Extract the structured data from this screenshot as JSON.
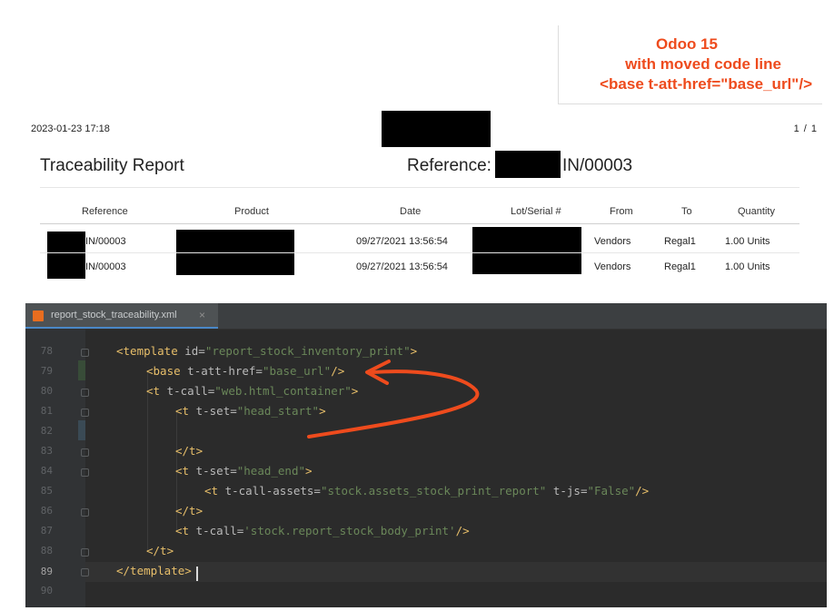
{
  "annotation": {
    "line1": "Odoo 15",
    "line2": "with moved code line",
    "line3": "<base t-att-href=\"base_url\"/>",
    "color": "#ee4b1d"
  },
  "report": {
    "print_date": "2023-01-23 17:18",
    "page": "1 / 1",
    "title": "Traceability Report",
    "reference_label": "Reference:",
    "reference_value": "IN/00003",
    "columns": [
      "Reference",
      "Product",
      "Date",
      "Lot/Serial #",
      "From",
      "To",
      "Quantity"
    ],
    "rows": [
      {
        "reference": "IN/00003",
        "date": "09/27/2021 13:56:54",
        "from": "Vendors",
        "to": "Regal1",
        "quantity": "1.00 Units"
      },
      {
        "reference": "IN/00003",
        "date": "09/27/2021 13:56:54",
        "from": "Vendors",
        "to": "Regal1",
        "quantity": "1.00 Units"
      }
    ]
  },
  "editor": {
    "tab_label": "report_stock_traceability.xml",
    "tab_icon": "xml-file-icon",
    "current_line": 89,
    "line_numbers": [
      "78",
      "79",
      "80",
      "81",
      "82",
      "83",
      "84",
      "85",
      "86",
      "87",
      "88",
      "89",
      "90"
    ],
    "code": {
      "l78_tag": "<template",
      "l78_attr": " id=",
      "l78_val": "\"report_stock_inventory_print\"",
      "l78_end": ">",
      "l79_tag": "<base",
      "l79_attr": " t-att-href=",
      "l79_val": "\"base_url\"",
      "l79_end": "/>",
      "l80_tag": "<t",
      "l80_attr": " t-call=",
      "l80_val": "\"web.html_container\"",
      "l80_end": ">",
      "l81_tag": "<t",
      "l81_attr": " t-set=",
      "l81_val": "\"head_start\"",
      "l81_end": ">",
      "l83_tag": "</t>",
      "l84_tag": "<t",
      "l84_attr": " t-set=",
      "l84_val": "\"head_end\"",
      "l84_end": ">",
      "l85_tag": "<t",
      "l85_attr": " t-call-assets=",
      "l85_val": "\"stock.assets_stock_print_report\"",
      "l85_attr2": " t-js=",
      "l85_val2": "\"False\"",
      "l85_end": "/>",
      "l86_tag": "</t>",
      "l87_tag": "<t",
      "l87_attr": " t-call=",
      "l87_val": "'stock.report_stock_body_print'",
      "l87_end": "/>",
      "l88_tag": "</t>",
      "l89_tag": "</template>"
    }
  }
}
